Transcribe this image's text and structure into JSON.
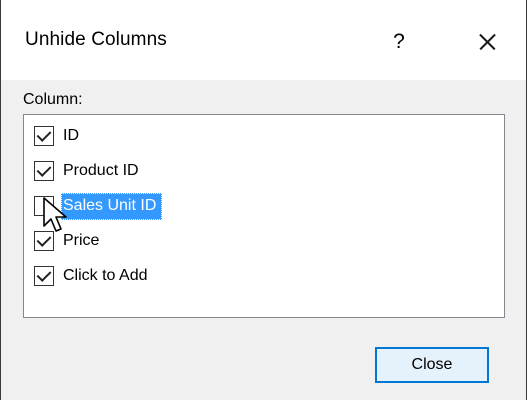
{
  "dialog": {
    "title": "Unhide Columns",
    "help_label": "?",
    "close_icon": "close-icon"
  },
  "columns": {
    "label": "Column:",
    "items": [
      {
        "label": "ID",
        "checked": true,
        "selected": false
      },
      {
        "label": "Product ID",
        "checked": true,
        "selected": false
      },
      {
        "label": "Sales Unit ID",
        "checked": false,
        "selected": true
      },
      {
        "label": "Price",
        "checked": true,
        "selected": false
      },
      {
        "label": "Click to Add",
        "checked": true,
        "selected": false
      }
    ]
  },
  "footer": {
    "close_label": "Close"
  },
  "colors": {
    "selection": "#3399ff",
    "button_focus_border": "#0078d7",
    "button_focus_fill": "#e5f1fb"
  },
  "cursor": "arrow-pointer-icon"
}
